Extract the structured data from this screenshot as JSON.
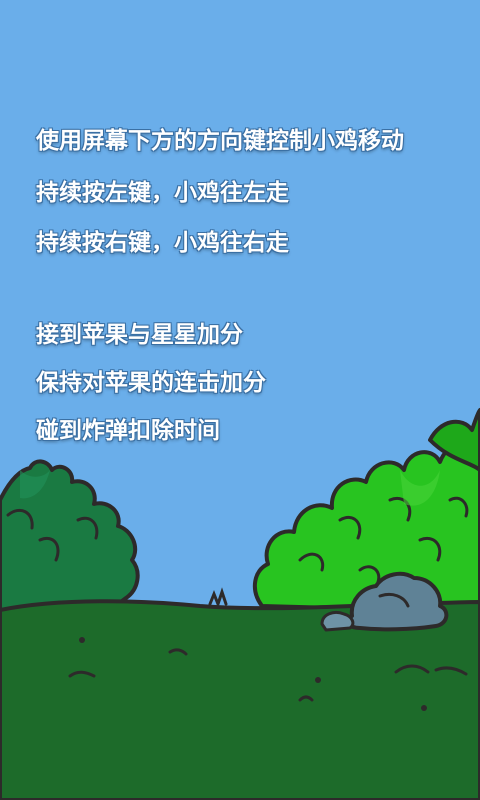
{
  "instructions": {
    "lines": [
      "使用屏幕下方的方向键控制小鸡移动",
      "持续按左键，小鸡往左走",
      "持续按右键，小鸡往右走",
      "接到苹果与星星加分",
      "保持对苹果的连击加分",
      "碰到炸弹扣除时间"
    ]
  },
  "colors": {
    "sky": "#6aaeea",
    "ground": "#1d6b2a",
    "bush_dark": "#1a7a42",
    "bush_light": "#28c420",
    "rock": "#5f8296",
    "outline": "#2d2a2a"
  },
  "icons": [
    "bush-left-icon",
    "bush-right-icon",
    "rock-icon",
    "grass-tuft-icon"
  ]
}
